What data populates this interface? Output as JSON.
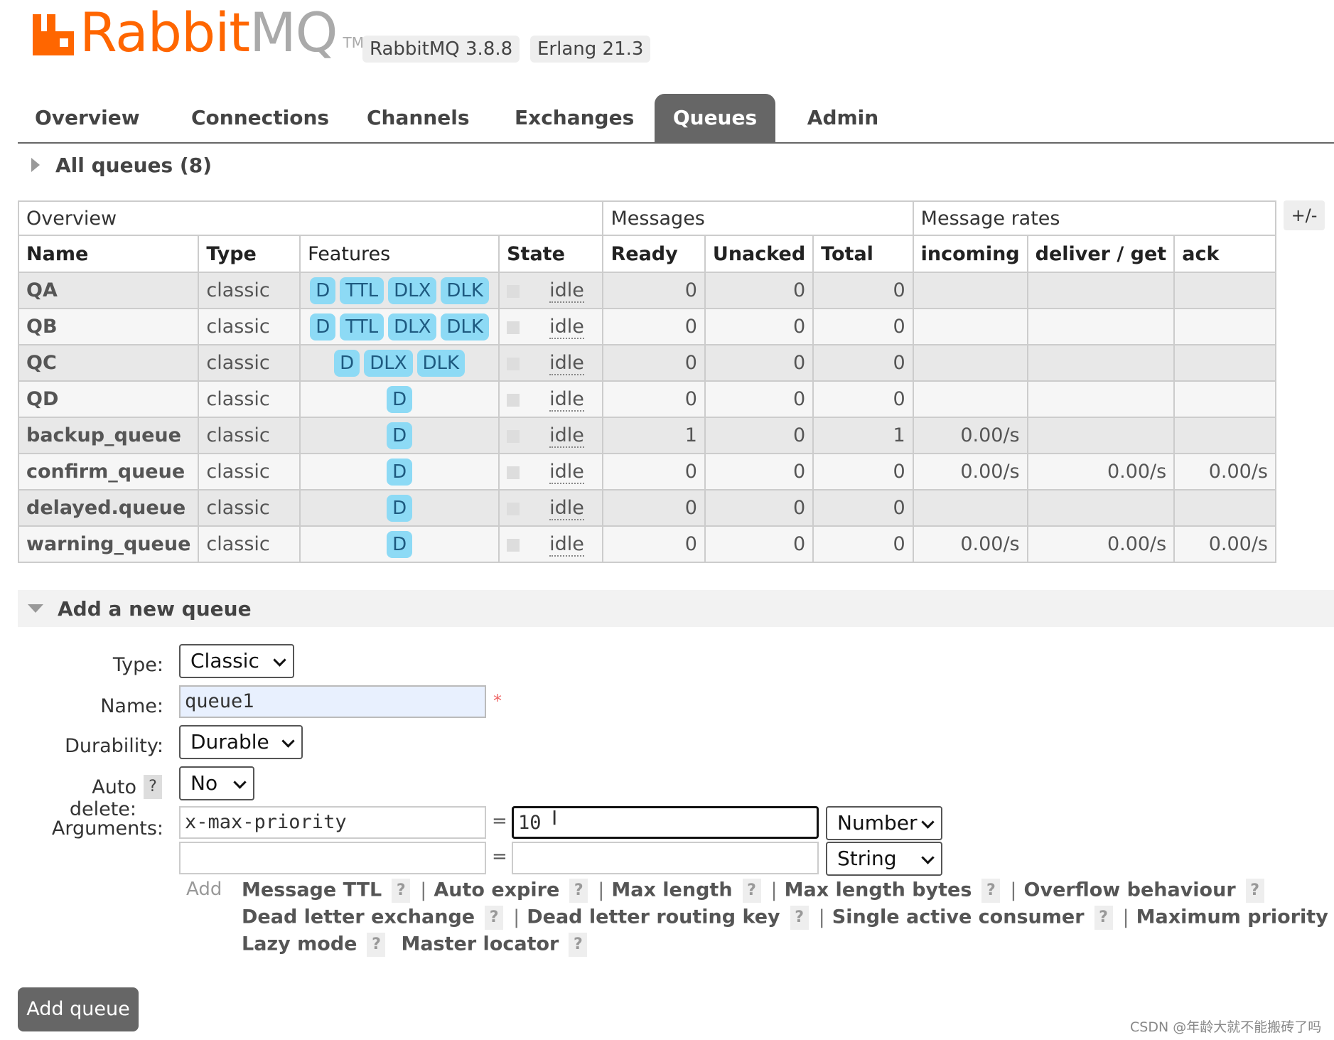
{
  "header": {
    "logo_rabbit": "Rabbit",
    "logo_mq": "MQ",
    "logo_tm": "TM",
    "version": "RabbitMQ 3.8.8",
    "erlang": "Erlang 21.3",
    "brand_color": "#ff6600"
  },
  "tabs": [
    {
      "label": "Overview",
      "active": false
    },
    {
      "label": "Connections",
      "active": false
    },
    {
      "label": "Channels",
      "active": false
    },
    {
      "label": "Exchanges",
      "active": false
    },
    {
      "label": "Queues",
      "active": true
    },
    {
      "label": "Admin",
      "active": false
    }
  ],
  "all_queues": {
    "title": "All queues (8)"
  },
  "table": {
    "groups": {
      "overview": "Overview",
      "messages": "Messages",
      "rates": "Message rates"
    },
    "columns": {
      "name": "Name",
      "type": "Type",
      "features": "Features",
      "state": "State",
      "ready": "Ready",
      "unacked": "Unacked",
      "total": "Total",
      "incoming": "incoming",
      "deliver_get": "deliver / get",
      "ack": "ack"
    },
    "toggle": "+/-",
    "rows": [
      {
        "name": "QA",
        "type": "classic",
        "features": [
          "D",
          "TTL",
          "DLX",
          "DLK"
        ],
        "state": "idle",
        "ready": "0",
        "unacked": "0",
        "total": "0",
        "incoming": "",
        "deliver_get": "",
        "ack": ""
      },
      {
        "name": "QB",
        "type": "classic",
        "features": [
          "D",
          "TTL",
          "DLX",
          "DLK"
        ],
        "state": "idle",
        "ready": "0",
        "unacked": "0",
        "total": "0",
        "incoming": "",
        "deliver_get": "",
        "ack": ""
      },
      {
        "name": "QC",
        "type": "classic",
        "features": [
          "D",
          "DLX",
          "DLK"
        ],
        "state": "idle",
        "ready": "0",
        "unacked": "0",
        "total": "0",
        "incoming": "",
        "deliver_get": "",
        "ack": ""
      },
      {
        "name": "QD",
        "type": "classic",
        "features": [
          "D"
        ],
        "state": "idle",
        "ready": "0",
        "unacked": "0",
        "total": "0",
        "incoming": "",
        "deliver_get": "",
        "ack": ""
      },
      {
        "name": "backup_queue",
        "type": "classic",
        "features": [
          "D"
        ],
        "state": "idle",
        "ready": "1",
        "unacked": "0",
        "total": "1",
        "incoming": "0.00/s",
        "deliver_get": "",
        "ack": ""
      },
      {
        "name": "confirm_queue",
        "type": "classic",
        "features": [
          "D"
        ],
        "state": "idle",
        "ready": "0",
        "unacked": "0",
        "total": "0",
        "incoming": "0.00/s",
        "deliver_get": "0.00/s",
        "ack": "0.00/s"
      },
      {
        "name": "delayed.queue",
        "type": "classic",
        "features": [
          "D"
        ],
        "state": "idle",
        "ready": "0",
        "unacked": "0",
        "total": "0",
        "incoming": "",
        "deliver_get": "",
        "ack": ""
      },
      {
        "name": "warning_queue",
        "type": "classic",
        "features": [
          "D"
        ],
        "state": "idle",
        "ready": "0",
        "unacked": "0",
        "total": "0",
        "incoming": "0.00/s",
        "deliver_get": "0.00/s",
        "ack": "0.00/s"
      }
    ]
  },
  "add_queue": {
    "title": "Add a new queue",
    "type_label": "Type:",
    "type_value": "Classic",
    "name_label": "Name:",
    "name_value": "queue1",
    "required_mark": "*",
    "durability_label": "Durability:",
    "durability_value": "Durable",
    "auto_delete_label": "Auto delete:",
    "auto_delete_help": "?",
    "auto_delete_value": "No",
    "arguments_label": "Arguments:",
    "eq": "=",
    "args": [
      {
        "key": "x-max-priority",
        "value": "10",
        "type": "Number"
      },
      {
        "key": "",
        "value": "",
        "type": "String"
      }
    ],
    "add_label": "Add",
    "shortcuts": [
      [
        "Message TTL",
        "Auto expire",
        "Max length",
        "Max length bytes",
        "Overflow behaviour"
      ],
      [
        "Dead letter exchange",
        "Dead letter routing key",
        "Single active consumer",
        "Maximum priority"
      ],
      [
        "Lazy mode",
        "Master locator"
      ]
    ],
    "help": "?",
    "separator": "|",
    "submit": "Add queue"
  },
  "watermark": "CSDN @年龄大就不能搬砖了吗"
}
